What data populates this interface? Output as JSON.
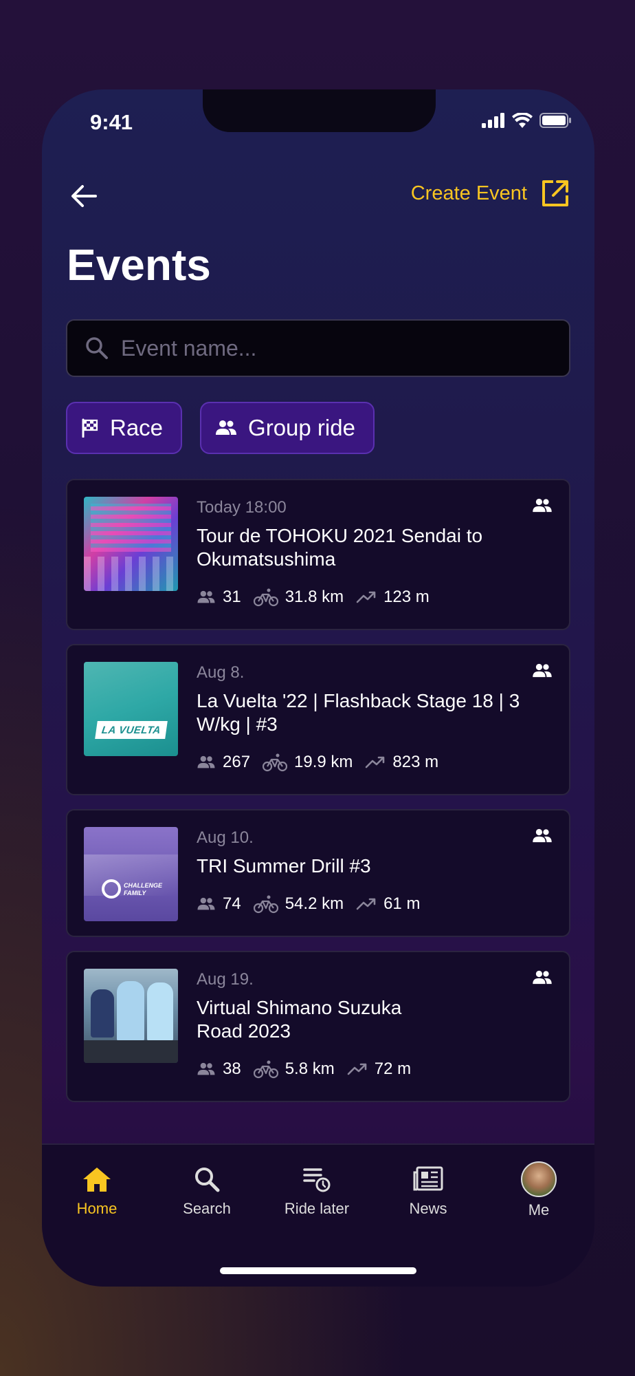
{
  "status_bar": {
    "time": "9:41"
  },
  "header": {
    "create_event_label": "Create Event",
    "title": "Events"
  },
  "search": {
    "placeholder": "Event name..."
  },
  "filters": [
    {
      "label": "Race",
      "icon": "checkered-flag-icon"
    },
    {
      "label": "Group ride",
      "icon": "group-icon"
    }
  ],
  "events": [
    {
      "date": "Today 18:00",
      "title": "Tour de TOHOKU 2021 Sendai to Okumatsushima",
      "riders": "31",
      "distance": "31.8 km",
      "elevation": "123 m"
    },
    {
      "date": "Aug 8.",
      "title": "La Vuelta '22 | Flashback Stage 18 | 3 W/kg | #3",
      "riders": "267",
      "distance": "19.9 km",
      "elevation": "823 m",
      "logo_text": "LA VUELTA"
    },
    {
      "date": "Aug 10.",
      "title": "TRI Summer Drill #3",
      "riders": "74",
      "distance": "54.2 km",
      "elevation": "61 m",
      "logo_text": "CHALLENGE FAMILY"
    },
    {
      "date": "Aug 19.",
      "title": "Virtual Shimano Suzuka Road 2023",
      "riders": "38",
      "distance": "5.8 km",
      "elevation": "72 m"
    }
  ],
  "tabs": [
    {
      "label": "Home",
      "icon": "home-icon"
    },
    {
      "label": "Search",
      "icon": "search-icon"
    },
    {
      "label": "Ride later",
      "icon": "ride-later-icon"
    },
    {
      "label": "News",
      "icon": "news-icon"
    },
    {
      "label": "Me",
      "icon": "avatar"
    }
  ],
  "colors": {
    "accent": "#f8c521",
    "chip_bg": "#3a1680",
    "card_bg": "#140b2a"
  }
}
